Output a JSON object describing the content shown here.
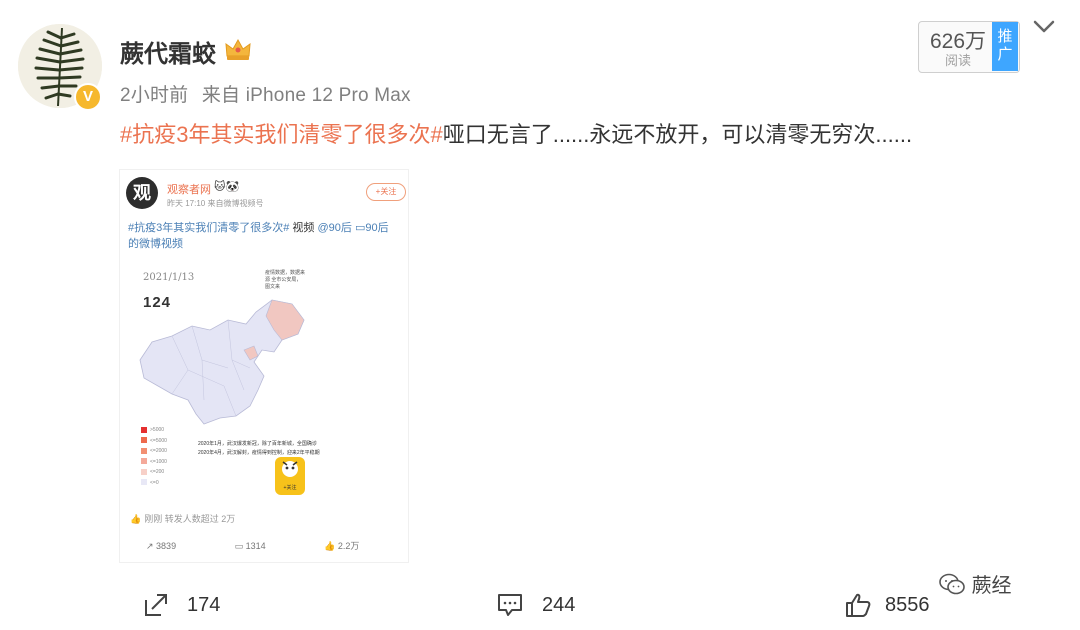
{
  "author": {
    "name": "蕨代霜蛟",
    "verified_badge": "V",
    "posted_time": "2小时前",
    "source": "来自 iPhone 12 Pro Max"
  },
  "reads": {
    "count": "626万",
    "label": "阅读",
    "promo_label": "推广"
  },
  "post": {
    "hashtag": "#抗疫3年其实我们清零了很多次#",
    "text": "哑口无言了......永远不放开，可以清零无穷次......"
  },
  "embedded": {
    "avatar_char": "观",
    "author": "观察者网",
    "badges": "🐱🐼",
    "meta": "昨天 17:10  来自微博视频号",
    "follow_label": "+关注",
    "hashtag": "#抗疫3年其实我们清零了很多次#",
    "text_plain": " 视频",
    "mention": "@90后",
    "video_link": "▭90后",
    "text_line2": "的微博视频",
    "map": {
      "date": "2021/1/13",
      "count": "124",
      "note": "疫情数据，数据来源 全市公安局，图文来",
      "legend": [
        {
          "label": ">5000",
          "color": "#e53030"
        },
        {
          "label": "<=5000",
          "color": "#ee6a4d"
        },
        {
          "label": "<=2000",
          "color": "#f28f72"
        },
        {
          "label": "<=1000",
          "color": "#f4a99a"
        },
        {
          "label": "<=200",
          "color": "#f7d0c8"
        },
        {
          "label": "<=0",
          "color": "#e8e8f6"
        }
      ],
      "caption1": "2020年1月，武汉爆发新冠，除了百年新城，全国确诊",
      "caption2": "2020年4月，武汉解封，疫情得到控制，迎来2年平稳期",
      "sticker_label": "+关注"
    },
    "forward_note": "刚刚 转发人数超过 2万",
    "shares": "3839",
    "comments": "1314",
    "likes": "2.2万"
  },
  "actions": {
    "shares": "174",
    "comments": "244",
    "likes": "8556"
  },
  "watermark": "蕨经",
  "colors": {
    "hashtag": "#eb7350",
    "promo": "#3ea6ff",
    "badge": "#f6b82d"
  }
}
